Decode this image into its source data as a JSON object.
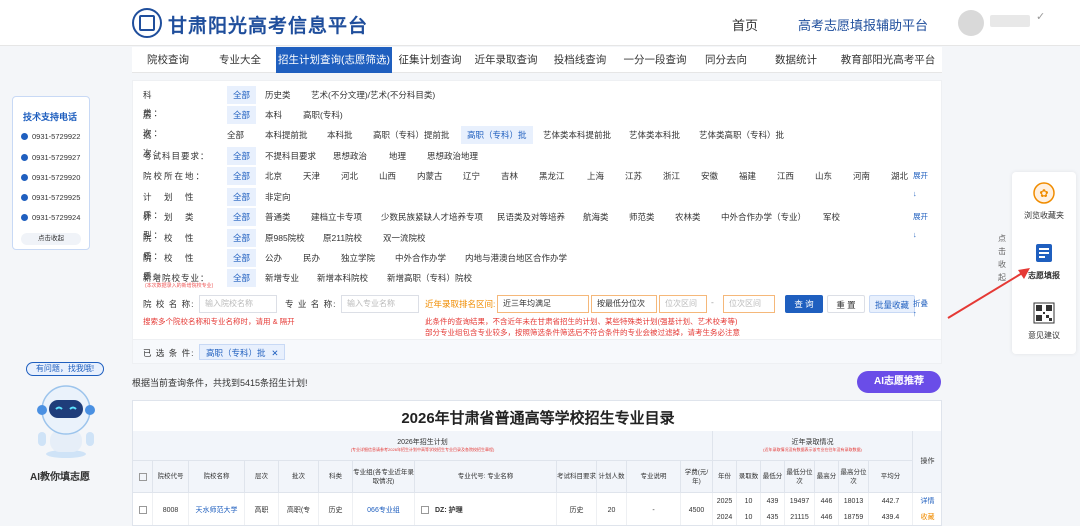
{
  "header": {
    "site_title": "甘肃阳光高考信息平台",
    "nav_home": "首页",
    "nav_assist": "高考志愿填报辅助平台"
  },
  "tabs": [
    "院校查询",
    "专业大全",
    "招生计划查询(志愿筛选)",
    "征集计划查询",
    "近年录取查询",
    "投档线查询",
    "一分一段查询",
    "同分去向",
    "数据统计",
    "教育部阳光高考平台"
  ],
  "filters": {
    "row1": {
      "label": "科　　　　　类：",
      "options": [
        "全部",
        "历史类",
        "艺术(不分文理)/艺术(不分科目类)"
      ]
    },
    "row2": {
      "label": "层　　　　　次：",
      "options": [
        "全部",
        "本科",
        "高职(专科)"
      ]
    },
    "row3": {
      "label": "批　　　　　次：",
      "options": [
        "全部",
        "本科提前批",
        "本科批",
        "高职（专科）提前批",
        "高职（专科）批",
        "艺体类本科提前批",
        "艺体类本科批",
        "艺体类高职（专科）批"
      ]
    },
    "row4": {
      "label": "考试科目要求：",
      "options": [
        "全部",
        "不提科目要求",
        "思想政治",
        "地理",
        "思想政治地理"
      ]
    },
    "row5": {
      "label": "院校所在地：",
      "options": [
        "全部",
        "北京",
        "天津",
        "河北",
        "山西",
        "内蒙古",
        "辽宁",
        "吉林",
        "黑龙江",
        "上海",
        "江苏",
        "浙江",
        "安徽",
        "福建",
        "江西",
        "山东",
        "河南",
        "湖北"
      ],
      "more": "展开 ↓"
    },
    "row6": {
      "label": "计　划　性　质：",
      "options": [
        "全部",
        "非定向"
      ]
    },
    "row7": {
      "label": "计　划　类　型：",
      "options": [
        "全部",
        "普通类",
        "建档立卡专项",
        "少数民族紧缺人才培养专项",
        "民语类及对等培养",
        "航海类",
        "师范类",
        "农林类",
        "中外合作办学（专业）",
        "军校"
      ],
      "more": "展开 ↓"
    },
    "row8": {
      "label": "院　校　性　质：",
      "options": [
        "全部",
        "原985院校",
        "原211院校",
        "双一流院校"
      ]
    },
    "row9": {
      "label": "院　校　性　质：",
      "options": [
        "全部",
        "公办",
        "民办",
        "独立学院",
        "中外合作办学",
        "内地与港澳台地区合作办学"
      ]
    },
    "row10": {
      "label": "新增院校专业：",
      "options": [
        "全部",
        "新增专业",
        "新增本科院校",
        "新增高职（专科）院校"
      ]
    },
    "tiny_note": "(本次数据录入的新增院校专业)"
  },
  "search": {
    "school_label": "院 校 名 称:",
    "school_placeholder": "输入院校名称",
    "major_label": "专 业 名 称:",
    "major_placeholder": "输入专业名称",
    "rank_label": "近年录取排名区间:",
    "year_select": "近三年均满足",
    "order_select": "按最低分位次",
    "range_from": "位次区间",
    "range_to": "位次区间",
    "search_btn": "查 询",
    "reset_btn": "重 置",
    "batch_btn": "批量收藏",
    "fold": "折叠 ↑",
    "hint_left": "搜索多个院校名称和专业名称时，请用 & 隔开",
    "hint_right_1": "此条件的查询结果，不含近年未在甘肃省招生的计划、某些特殊类计划(强基计划、艺术校考等)",
    "hint_right_2": "部分专业组包含专业较多，按照筛选条件筛选后不符合条件的专业会被过滤掉，请考生务必注意"
  },
  "selected": {
    "label": "已 选 条 件:",
    "chip": "高职（专科）批"
  },
  "left_panel": {
    "title": "技术支持电话",
    "phones": [
      "0931-5729922",
      "0931-5729927",
      "0931-5729920",
      "0931-5729925",
      "0931-5729924"
    ],
    "collapse": "点击收起"
  },
  "ai_helper": {
    "bubble": "有问题，找我哦!",
    "caption": "AI教你填志愿"
  },
  "right_panel": {
    "collapse_vertical": "点击收起",
    "items": [
      "浏览收藏夹",
      "志愿填报",
      "意见建议"
    ]
  },
  "results": {
    "count_text": "根据当前查询条件，共找到5415条招生计划!",
    "ai_recommend": "AI志愿推荐"
  },
  "table": {
    "title": "2026年甘肃省普通高等学校招生专业目录",
    "plan_header": "2026年招生计划",
    "plan_sub": "(专业详细信息请参考2026年招生计划中高等学校招生专业目录及各院校招生章程)",
    "recent_header": "近年录取情况",
    "recent_sub": "(近年录取情况没有数据表示该专业在往年没有录取数据)",
    "op_header": "操作",
    "columns": [
      "院校代号",
      "院校名称",
      "层次",
      "批次",
      "科类",
      "专业组(各专业近年录取情况)",
      "专业代号: 专业名称",
      "考试科目要求",
      "计划人数",
      "专业说明",
      "学费(元/年)",
      "年份",
      "录取数",
      "最低分",
      "最低分位次",
      "最高分",
      "最高分位次",
      "平均分"
    ],
    "row": {
      "school_code": "8008",
      "school_name": "天水师范大学",
      "level": "高职",
      "batch": "高职(专",
      "category": "历史",
      "group": "066专业组",
      "major": "DZ: 护理",
      "subject": "历史",
      "plan": "20",
      "note": "-",
      "fee": "4500",
      "years": [
        {
          "year": "2025",
          "count": "10",
          "min": "439",
          "min_rank": "19497",
          "max": "446",
          "max_rank": "18013",
          "avg": "442.7"
        },
        {
          "year": "2024",
          "count": "10",
          "min": "435",
          "min_rank": "21115",
          "max": "446",
          "max_rank": "18759",
          "avg": "439.4"
        }
      ],
      "op_detail": "详情",
      "op_fav": "收藏"
    }
  },
  "colors": {
    "brand": "#1f5fbf",
    "accent_purple": "#6a4de8",
    "warning": "#e53935"
  }
}
